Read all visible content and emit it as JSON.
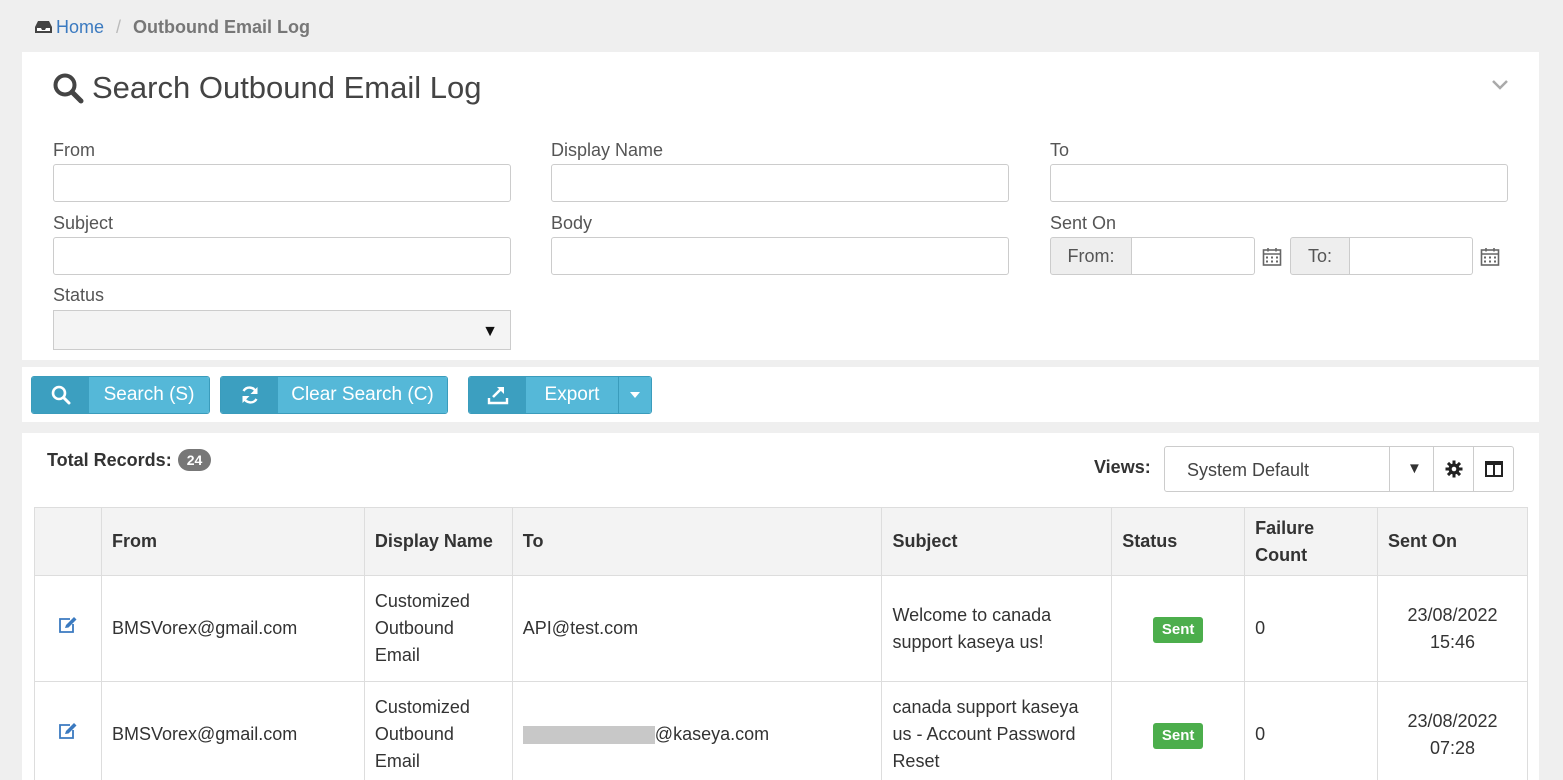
{
  "breadcrumb": {
    "home": "Home",
    "separator": "/",
    "current": "Outbound Email Log"
  },
  "search": {
    "title": "Search Outbound Email Log",
    "fields": {
      "from": {
        "label": "From",
        "value": ""
      },
      "display_name": {
        "label": "Display Name",
        "value": ""
      },
      "to": {
        "label": "To",
        "value": ""
      },
      "subject": {
        "label": "Subject",
        "value": ""
      },
      "body": {
        "label": "Body",
        "value": ""
      },
      "sent_on": {
        "label": "Sent On",
        "from_label": "From:",
        "to_label": "To:"
      },
      "status": {
        "label": "Status",
        "value": ""
      }
    }
  },
  "toolbar": {
    "search_label": "Search (S)",
    "clear_label": "Clear Search (C)",
    "export_label": "Export"
  },
  "results": {
    "total_label": "Total Records:",
    "total_count": "24",
    "views_label": "Views:",
    "views_value": "System Default",
    "columns": [
      "From",
      "Display Name",
      "To",
      "Subject",
      "Status",
      "Failure Count",
      "Sent On"
    ],
    "rows": [
      {
        "from": "BMSVorex@gmail.com",
        "display_name": "Customized Outbound Email",
        "to": "API@test.com",
        "subject": "Welcome to canada support kaseya us!",
        "status": "Sent",
        "failure_count": "0",
        "sent_on_date": "23/08/2022",
        "sent_on_time": "15:46"
      },
      {
        "from": "BMSVorex@gmail.com",
        "display_name": "Customized Outbound Email",
        "to": "@kaseya.com",
        "subject": "canada support kaseya us - Account Password Reset",
        "status": "Sent",
        "failure_count": "0",
        "sent_on_date": "23/08/2022",
        "sent_on_time": "07:28"
      }
    ]
  },
  "colors": {
    "link": "#3b7ac0",
    "button_primary": "#55b8d8",
    "button_icon": "#3c9fc0",
    "status_sent": "#4cae4c",
    "badge": "#777777"
  }
}
